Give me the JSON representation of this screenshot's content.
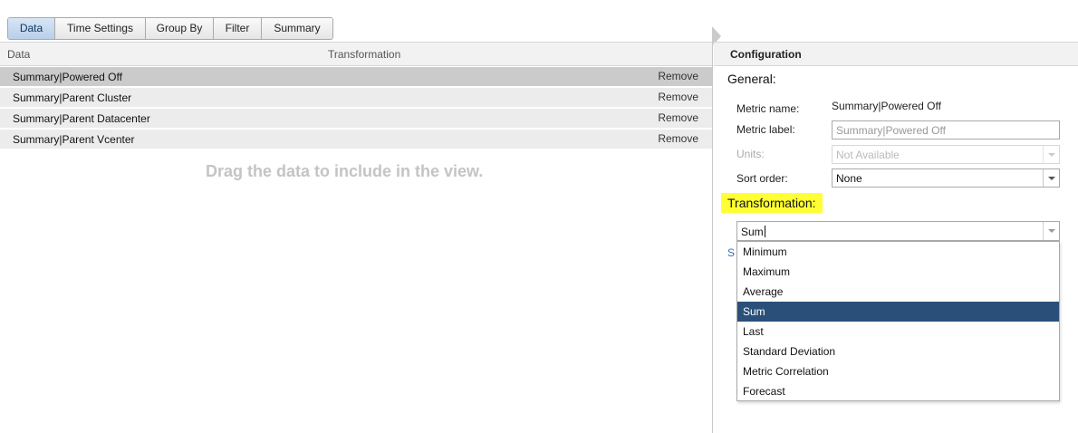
{
  "tabs": [
    {
      "label": "Data",
      "active": true
    },
    {
      "label": "Time Settings",
      "active": false
    },
    {
      "label": "Group By",
      "active": false
    },
    {
      "label": "Filter",
      "active": false
    },
    {
      "label": "Summary",
      "active": false
    }
  ],
  "data_panel": {
    "column_data": "Data",
    "column_transformation": "Transformation",
    "rows": [
      {
        "name": "Summary|Powered Off",
        "action": "Remove",
        "selected": true
      },
      {
        "name": "Summary|Parent Cluster",
        "action": "Remove",
        "selected": false
      },
      {
        "name": "Summary|Parent Datacenter",
        "action": "Remove",
        "selected": false
      },
      {
        "name": "Summary|Parent Vcenter",
        "action": "Remove",
        "selected": false
      }
    ],
    "drag_hint": "Drag the data to include in the view."
  },
  "config": {
    "header": "Configuration",
    "general": "General:",
    "metric_name_label": "Metric name:",
    "metric_name_value": "Summary|Powered Off",
    "metric_label_label": "Metric label:",
    "metric_label_placeholder": "Summary|Powered Off",
    "units_label": "Units:",
    "units_value": "Not Available",
    "sort_order_label": "Sort order:",
    "sort_order_value": "None",
    "transformation_label": "Transformation:",
    "transformation_value": "Sum",
    "behind_link": "S",
    "highlight_color": "#ffff33",
    "selected_option_color": "#2a5079",
    "transformation_options": [
      {
        "label": "Minimum",
        "selected": false
      },
      {
        "label": "Maximum",
        "selected": false
      },
      {
        "label": "Average",
        "selected": false
      },
      {
        "label": "Sum",
        "selected": true
      },
      {
        "label": "Last",
        "selected": false
      },
      {
        "label": "Standard Deviation",
        "selected": false
      },
      {
        "label": "Metric Correlation",
        "selected": false
      },
      {
        "label": "Forecast",
        "selected": false
      }
    ]
  }
}
